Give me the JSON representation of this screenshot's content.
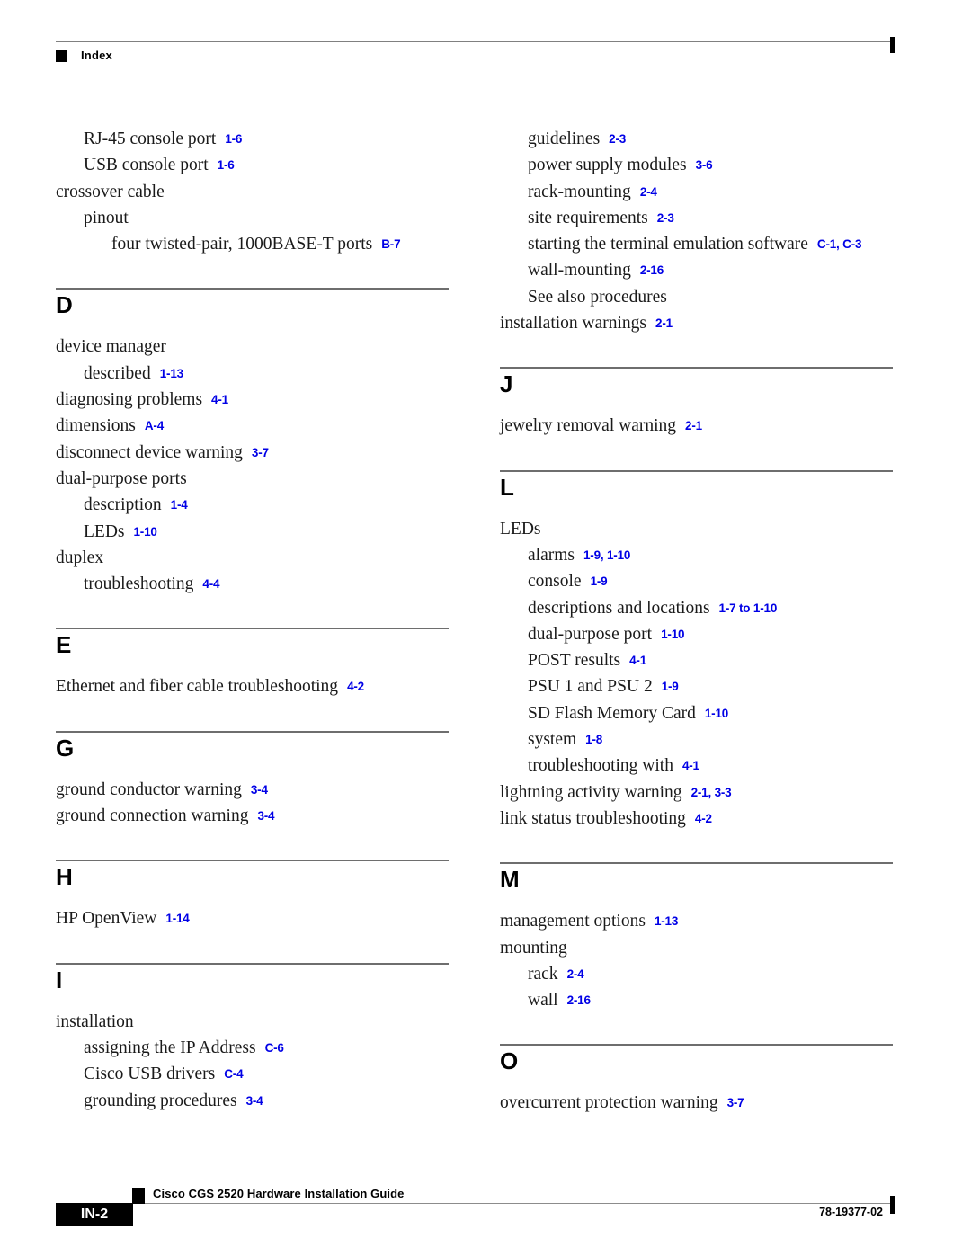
{
  "header": {
    "label": "Index",
    "marker_icon": "black-square-icon"
  },
  "footer": {
    "page_number": "IN-2",
    "document_title": "Cisco CGS 2520 Hardware Installation Guide",
    "document_number": "78-19377-02",
    "marker_icon": "black-square-icon"
  },
  "colors": {
    "page_reference": "#0000e6",
    "rule": "#6e6e6e",
    "text": "#1a1a1a"
  },
  "columns": [
    {
      "name": "left-column",
      "blocks": [
        {
          "letter": null,
          "show_divider": false,
          "entries": [
            {
              "level": 1,
              "text": "RJ-45 console port",
              "ref": "1-6"
            },
            {
              "level": 1,
              "text": "USB console port",
              "ref": "1-6"
            },
            {
              "level": 0,
              "text": "crossover cable",
              "ref": ""
            },
            {
              "level": 1,
              "text": "pinout",
              "ref": ""
            },
            {
              "level": 2,
              "text": "four twisted-pair, 1000BASE-T ports",
              "ref": "B-7"
            }
          ]
        },
        {
          "letter": "D",
          "show_divider": true,
          "entries": [
            {
              "level": 0,
              "text": "device manager",
              "ref": ""
            },
            {
              "level": 1,
              "text": "described",
              "ref": "1-13"
            },
            {
              "level": 0,
              "text": "diagnosing problems",
              "ref": "4-1"
            },
            {
              "level": 0,
              "text": "dimensions",
              "ref": "A-4"
            },
            {
              "level": 0,
              "text": "disconnect device warning",
              "ref": "3-7"
            },
            {
              "level": 0,
              "text": "dual-purpose ports",
              "ref": ""
            },
            {
              "level": 1,
              "text": "description",
              "ref": "1-4"
            },
            {
              "level": 1,
              "text": "LEDs",
              "ref": "1-10"
            },
            {
              "level": 0,
              "text": "duplex",
              "ref": ""
            },
            {
              "level": 1,
              "text": "troubleshooting",
              "ref": "4-4"
            }
          ]
        },
        {
          "letter": "E",
          "show_divider": true,
          "entries": [
            {
              "level": 0,
              "text": "Ethernet and fiber cable troubleshooting",
              "ref": "4-2"
            }
          ]
        },
        {
          "letter": "G",
          "show_divider": true,
          "entries": [
            {
              "level": 0,
              "text": "ground conductor warning",
              "ref": "3-4"
            },
            {
              "level": 0,
              "text": "ground connection warning",
              "ref": "3-4"
            }
          ]
        },
        {
          "letter": "H",
          "show_divider": true,
          "entries": [
            {
              "level": 0,
              "text": "HP OpenView",
              "ref": "1-14"
            }
          ]
        },
        {
          "letter": "I",
          "show_divider": true,
          "entries": [
            {
              "level": 0,
              "text": "installation",
              "ref": ""
            },
            {
              "level": 1,
              "text": "assigning the IP Address",
              "ref": "C-6"
            },
            {
              "level": 1,
              "text": "Cisco USB drivers",
              "ref": "C-4"
            },
            {
              "level": 1,
              "text": "grounding procedures",
              "ref": "3-4"
            }
          ]
        }
      ]
    },
    {
      "name": "right-column",
      "blocks": [
        {
          "letter": null,
          "show_divider": false,
          "entries": [
            {
              "level": 1,
              "text": "guidelines",
              "ref": "2-3"
            },
            {
              "level": 1,
              "text": "power supply modules",
              "ref": "3-6"
            },
            {
              "level": 1,
              "text": "rack-mounting",
              "ref": "2-4"
            },
            {
              "level": 1,
              "text": "site requirements",
              "ref": "2-3"
            },
            {
              "level": 1,
              "text": "starting the terminal emulation software",
              "ref": "C-1, C-3"
            },
            {
              "level": 1,
              "text": "wall-mounting",
              "ref": "2-16"
            },
            {
              "level": 1,
              "text": "See also procedures",
              "ref": ""
            },
            {
              "level": 0,
              "text": "installation warnings",
              "ref": "2-1"
            }
          ]
        },
        {
          "letter": "J",
          "show_divider": true,
          "entries": [
            {
              "level": 0,
              "text": "jewelry removal warning",
              "ref": "2-1"
            }
          ]
        },
        {
          "letter": "L",
          "show_divider": true,
          "entries": [
            {
              "level": 0,
              "text": "LEDs",
              "ref": ""
            },
            {
              "level": 1,
              "text": "alarms",
              "ref": "1-9, 1-10"
            },
            {
              "level": 1,
              "text": "console",
              "ref": "1-9"
            },
            {
              "level": 1,
              "text": "descriptions and locations",
              "ref": "1-7 to 1-10"
            },
            {
              "level": 1,
              "text": "dual-purpose port",
              "ref": "1-10"
            },
            {
              "level": 1,
              "text": "POST results",
              "ref": "4-1"
            },
            {
              "level": 1,
              "text": "PSU 1 and PSU 2",
              "ref": "1-9"
            },
            {
              "level": 1,
              "text": "SD Flash Memory Card",
              "ref": "1-10"
            },
            {
              "level": 1,
              "text": "system",
              "ref": "1-8"
            },
            {
              "level": 1,
              "text": "troubleshooting with",
              "ref": "4-1"
            },
            {
              "level": 0,
              "text": "lightning activity warning",
              "ref": "2-1, 3-3"
            },
            {
              "level": 0,
              "text": "link status troubleshooting",
              "ref": "4-2"
            }
          ]
        },
        {
          "letter": "M",
          "show_divider": true,
          "entries": [
            {
              "level": 0,
              "text": "management options",
              "ref": "1-13"
            },
            {
              "level": 0,
              "text": "mounting",
              "ref": ""
            },
            {
              "level": 1,
              "text": "rack",
              "ref": "2-4"
            },
            {
              "level": 1,
              "text": "wall",
              "ref": "2-16"
            }
          ]
        },
        {
          "letter": "O",
          "show_divider": true,
          "entries": [
            {
              "level": 0,
              "text": "overcurrent protection warning",
              "ref": "3-7"
            }
          ]
        }
      ]
    }
  ]
}
